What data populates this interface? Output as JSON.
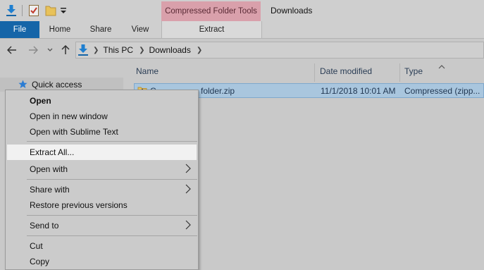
{
  "window": {
    "title": "Downloads"
  },
  "quick_access": {
    "icons": [
      "down-arrow-icon",
      "checklist-icon",
      "folder-icon",
      "customize-chevron-icon"
    ]
  },
  "ribbon": {
    "contextual_group": "Compressed Folder Tools",
    "tabs": [
      {
        "label": "File"
      },
      {
        "label": "Home"
      },
      {
        "label": "Share"
      },
      {
        "label": "View"
      },
      {
        "label": "Extract"
      }
    ]
  },
  "address": {
    "crumbs": [
      "This PC",
      "Downloads"
    ]
  },
  "nav": {
    "quick_access_label": "Quick access"
  },
  "file_list": {
    "columns": [
      "Name",
      "Date modified",
      "Type"
    ],
    "rows": [
      {
        "name_visible": "folder.zip",
        "name_prefix_visible": "C",
        "date": "11/1/2018 10:01 AM",
        "type": "Compressed (zipp..."
      }
    ]
  },
  "context_menu": {
    "items": [
      {
        "label": "Open",
        "bold": true
      },
      {
        "label": "Open in new window"
      },
      {
        "label": "Open with Sublime Text"
      },
      {
        "label": "Extract All..."
      },
      {
        "label": "Open with"
      },
      {
        "label": "Share with"
      },
      {
        "label": "Restore previous versions"
      },
      {
        "label": "Send to"
      },
      {
        "label": "Cut"
      },
      {
        "label": "Copy"
      }
    ]
  },
  "colors": {
    "file_tab": "#1565a8",
    "contextual_tab": "#d9a0ab",
    "selection": "#a9c6de",
    "highlight": "#f1f1f1"
  }
}
